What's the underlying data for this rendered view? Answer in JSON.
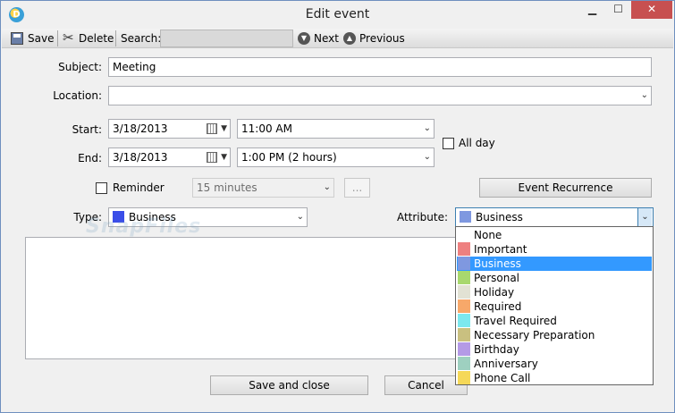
{
  "window": {
    "title": "Edit event"
  },
  "toolbar": {
    "save_label": "Save",
    "delete_label": "Delete",
    "search_label": "Search:",
    "search_value": "",
    "next_label": "Next",
    "previous_label": "Previous"
  },
  "form": {
    "subject_label": "Subject:",
    "subject_value": "Meeting",
    "location_label": "Location:",
    "location_value": "",
    "start_label": "Start:",
    "start_date": "3/18/2013",
    "start_time": "11:00 AM",
    "end_label": "End:",
    "end_date": "3/18/2013",
    "end_time": "1:00 PM (2 hours)",
    "all_day_label": "All day",
    "all_day_checked": false,
    "reminder_label": "Reminder",
    "reminder_checked": false,
    "reminder_value": "15 minutes",
    "ellipsis_label": "...",
    "recurrence_label": "Event Recurrence",
    "type_label": "Type:",
    "type_value": "Business",
    "type_color": "#3a4ee8",
    "attribute_label": "Attribute:",
    "attribute_value": "Business",
    "attribute_color": "#7f98e0",
    "notes": ""
  },
  "attribute_options": [
    {
      "label": "None",
      "color": "#ffffff"
    },
    {
      "label": "Important",
      "color": "#ee8080"
    },
    {
      "label": "Business",
      "color": "#7f98e0",
      "selected": true
    },
    {
      "label": "Personal",
      "color": "#a8d86e"
    },
    {
      "label": "Holiday",
      "color": "#e2e2d4"
    },
    {
      "label": "Required",
      "color": "#f7a86a"
    },
    {
      "label": "Travel Required",
      "color": "#7ce8ee"
    },
    {
      "label": "Necessary Preparation",
      "color": "#c9c080"
    },
    {
      "label": "Birthday",
      "color": "#b49ae6"
    },
    {
      "label": "Anniversary",
      "color": "#9ed0c0"
    },
    {
      "label": "Phone Call",
      "color": "#f5d858"
    }
  ],
  "footer": {
    "save_close_label": "Save and close",
    "cancel_label": "Cancel"
  },
  "watermark": "SnapFiles"
}
